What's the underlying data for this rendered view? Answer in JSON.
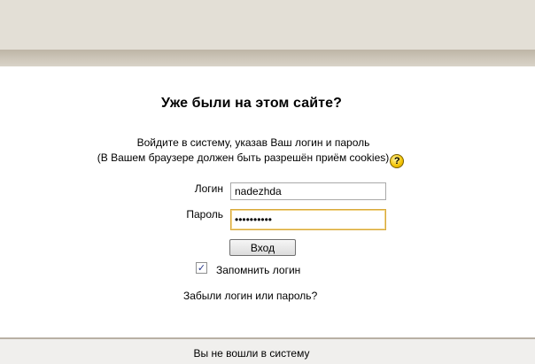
{
  "login": {
    "heading": "Уже были на этом сайте?",
    "instructions_line1": "Войдите в систему, указав Ваш логин и пароль",
    "instructions_line2": "(В Вашем браузере должен быть разрешён приём cookies)",
    "help_icon": "question-mark-icon",
    "username_label": "Логин",
    "username_value": "nadezhda",
    "password_label": "Пароль",
    "password_value": "••••••••••",
    "submit_label": "Вход",
    "remember_label": "Запомнить логин",
    "remember_checked": true,
    "checkmark": "✓",
    "forgot_link": "Забыли логин или пароль?"
  },
  "footer": {
    "status_text": "Вы не вошли в систему"
  },
  "colors": {
    "header_band": "#e3dfd6",
    "focus_border": "#d8a93a",
    "footer_bg": "#f0efed"
  }
}
